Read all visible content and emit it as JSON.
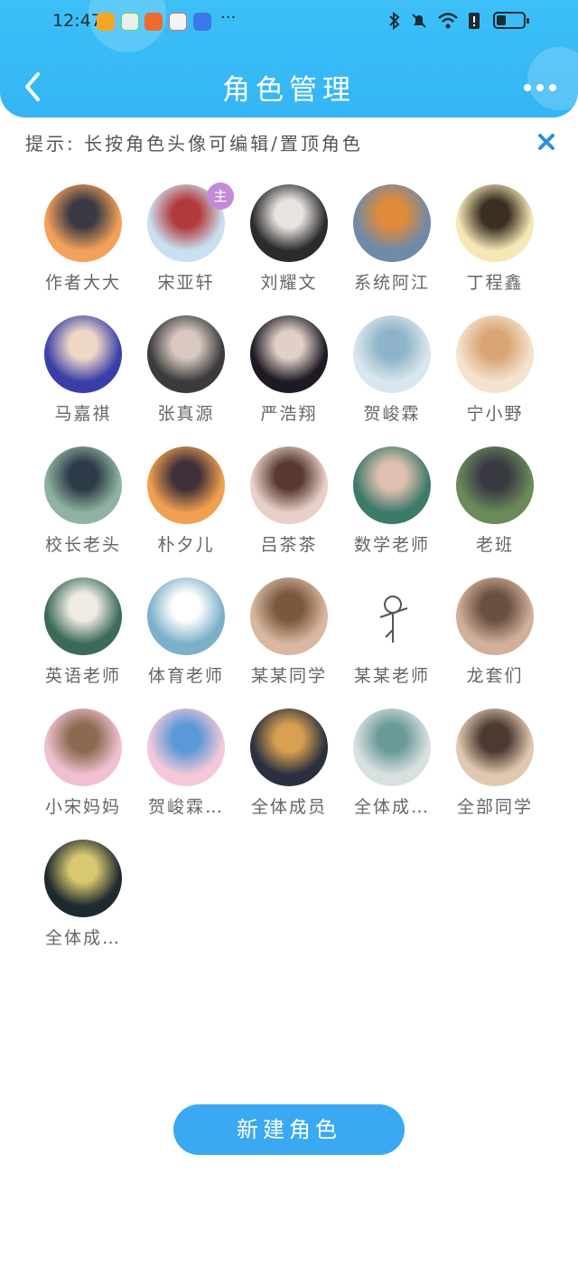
{
  "status_bar": {
    "time": "12:47",
    "more": "···"
  },
  "header": {
    "title": "角色管理"
  },
  "tip": {
    "text": "提示: 长按角色头像可编辑/置顶角色"
  },
  "roles": [
    {
      "name": "作者大大",
      "avatar": "sunset-silhouette",
      "colors": [
        "#f2a15a",
        "#3b3a44"
      ]
    },
    {
      "name": "宋亚轩",
      "avatar": "boy-red-outfit",
      "colors": [
        "#c9e0f0",
        "#b23a3a"
      ],
      "badge": "主"
    },
    {
      "name": "刘耀文",
      "avatar": "boy-white-shirt",
      "colors": [
        "#2b2b2b",
        "#e8e4e0"
      ]
    },
    {
      "name": "系统阿江",
      "avatar": "piano-fire",
      "colors": [
        "#6f8aa8",
        "#e08a3a"
      ]
    },
    {
      "name": "丁程鑫",
      "avatar": "light-figure",
      "colors": [
        "#f6e7b6",
        "#3a3020"
      ]
    },
    {
      "name": "马嘉祺",
      "avatar": "boy-blue-light",
      "colors": [
        "#3a3fa8",
        "#f0d8c8"
      ]
    },
    {
      "name": "张真源",
      "avatar": "boy-dark",
      "colors": [
        "#3b3b3b",
        "#d8c8c0"
      ]
    },
    {
      "name": "严浩翔",
      "avatar": "boy-dark-bg",
      "colors": [
        "#1e1a24",
        "#e0d0c8"
      ]
    },
    {
      "name": "贺峻霖",
      "avatar": "boy-peace-sign",
      "colors": [
        "#d8e6ef",
        "#8fb3c8"
      ]
    },
    {
      "name": "宁小野",
      "avatar": "anime-boy",
      "colors": [
        "#f5e3cf",
        "#d9a574"
      ]
    },
    {
      "name": "校长老头",
      "avatar": "old-man-glasses",
      "colors": [
        "#8fb3a0",
        "#2d3a48"
      ]
    },
    {
      "name": "朴夕儿",
      "avatar": "girl-sunset",
      "colors": [
        "#f0a050",
        "#40303a"
      ]
    },
    {
      "name": "吕茶茶",
      "avatar": "girl-bangs",
      "colors": [
        "#e8d0c8",
        "#5a3a30"
      ]
    },
    {
      "name": "数学老师",
      "avatar": "teacher-chalkboard",
      "colors": [
        "#3c7a6a",
        "#e0c0b0"
      ]
    },
    {
      "name": "老班",
      "avatar": "man-outdoors",
      "colors": [
        "#6a8a5a",
        "#3a3a42"
      ]
    },
    {
      "name": "英语老师",
      "avatar": "girl-book",
      "colors": [
        "#3c6a58",
        "#f0ece4"
      ]
    },
    {
      "name": "体育老师",
      "avatar": "man-lake",
      "colors": [
        "#7cb0c8",
        "#ffffff"
      ]
    },
    {
      "name": "某某同学",
      "avatar": "cat-face",
      "colors": [
        "#d8b8a0",
        "#7a5840"
      ]
    },
    {
      "name": "某某老师",
      "avatar": "stick-figure",
      "colors": [
        "#ffffff",
        "#555555"
      ]
    },
    {
      "name": "龙套们",
      "avatar": "cat-face",
      "colors": [
        "#d0b098",
        "#6a5040"
      ]
    },
    {
      "name": "小宋妈妈",
      "avatar": "lotus-baby",
      "colors": [
        "#f0c0d0",
        "#8a6a50"
      ]
    },
    {
      "name": "贺峻霖…",
      "avatar": "lotus-baby",
      "colors": [
        "#f4c8d8",
        "#5a98d8"
      ]
    },
    {
      "name": "全体成员",
      "avatar": "group-fireworks",
      "colors": [
        "#2a3040",
        "#d8a050"
      ]
    },
    {
      "name": "全体成…",
      "avatar": "group-stage",
      "colors": [
        "#d8e0e0",
        "#6a9a98"
      ]
    },
    {
      "name": "全部同学",
      "avatar": "cat-face",
      "colors": [
        "#e0c8b0",
        "#4a3a30"
      ]
    },
    {
      "name": "全体成…",
      "avatar": "group-stage-lights",
      "colors": [
        "#1e2a30",
        "#d8c870"
      ]
    }
  ],
  "new_role_button": {
    "label": "新建角色"
  },
  "colors": {
    "accent": "#3aa9f2",
    "header": "#3cc0f7",
    "badge": "#c48ad8"
  }
}
